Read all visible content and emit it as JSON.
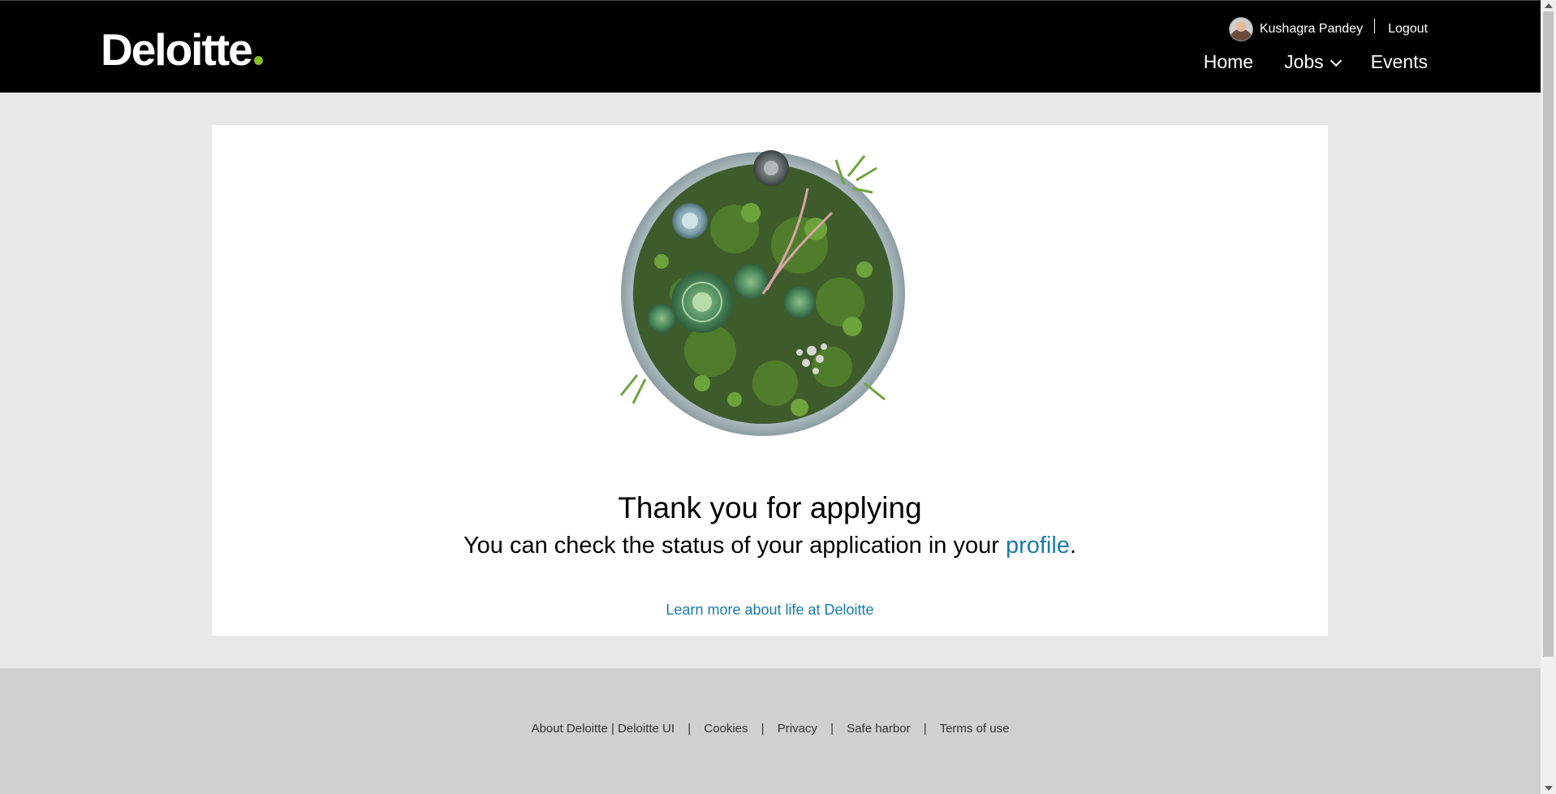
{
  "header": {
    "logo_text": "Deloitte",
    "user": {
      "name": "Kushagra Pandey",
      "logout_label": "Logout"
    },
    "nav": {
      "home": "Home",
      "jobs": "Jobs",
      "events": "Events"
    }
  },
  "main": {
    "title": "Thank you for applying",
    "subtitle_prefix": "You can check the status of your application in your ",
    "subtitle_link": "profile",
    "subtitle_suffix": ".",
    "learn_more": "Learn more about life at Deloitte"
  },
  "footer": {
    "links": [
      "About Deloitte | Deloitte UI",
      "Cookies",
      "Privacy",
      "Safe harbor",
      "Terms of use"
    ],
    "separator": "|"
  },
  "colors": {
    "brand_green": "#86bc25",
    "link_blue": "#1a7aa9",
    "header_bg": "#000000",
    "page_bg": "#e7e8e7",
    "footer_bg": "#d0d0cf"
  }
}
